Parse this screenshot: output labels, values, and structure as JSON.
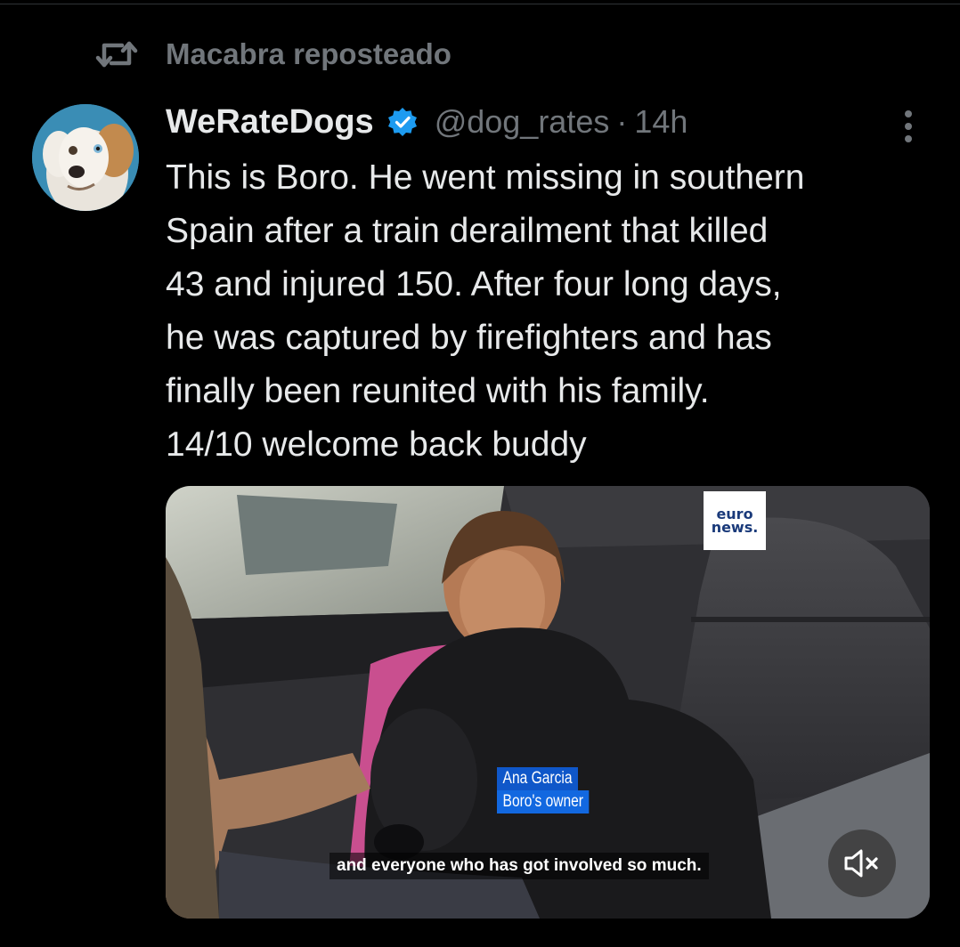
{
  "repost": {
    "label": "Macabra reposteado",
    "icon": "repost-icon"
  },
  "author": {
    "display_name": "WeRateDogs",
    "handle": "@dog_rates",
    "separator": "·",
    "time": "14h",
    "verified": true,
    "verified_color": "#1d9bf0"
  },
  "tweet": {
    "text": "This is Boro. He went missing in southern\nSpain after a train derailment that killed\n43 and injured 150. After four long days,\nhe was captured by firefighters and has\nfinally been reunited with his family.\n14/10 welcome back buddy"
  },
  "media": {
    "type": "video",
    "logo_line1": "euro",
    "logo_line2": "news.",
    "lower_third_name": "Ana Garcia",
    "lower_third_role": "Boro's owner",
    "subtitle": "and everyone who has got involved so much.",
    "mute_icon": "volume-muted-icon"
  },
  "colors": {
    "background": "#000000",
    "text_primary": "#e7e9ea",
    "text_secondary": "#71767b",
    "accent": "#1d9bf0"
  }
}
